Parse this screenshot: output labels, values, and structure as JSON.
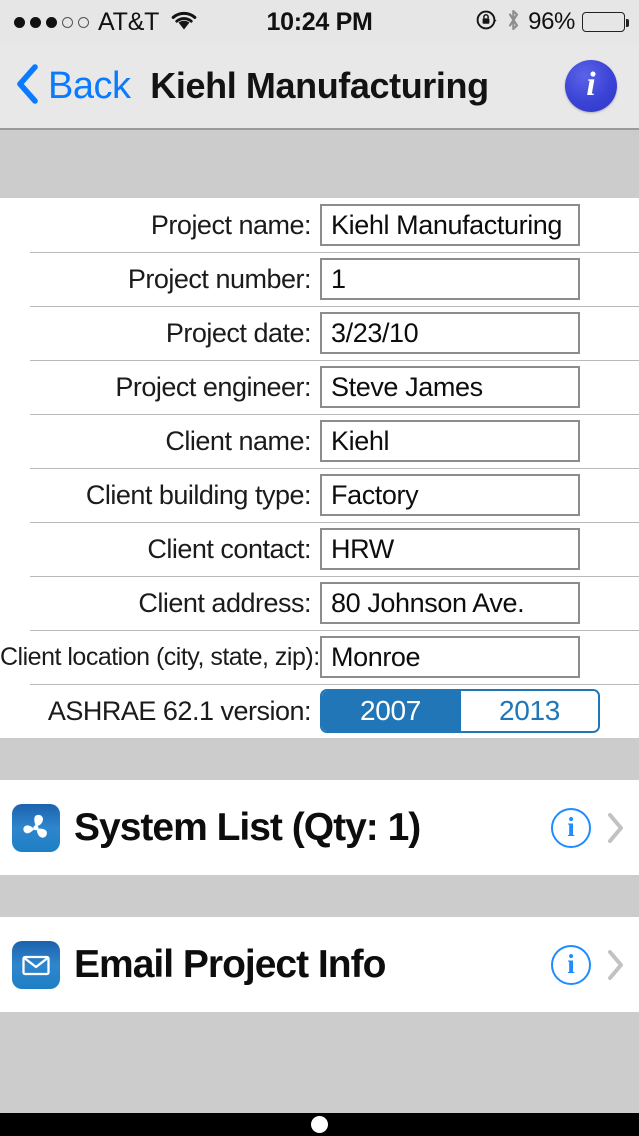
{
  "status_bar": {
    "carrier": "AT&T",
    "signal_filled": 3,
    "signal_total": 5,
    "time": "10:24 PM",
    "battery_percent": "96%",
    "battery_level": 96,
    "icons": [
      "wifi-icon",
      "rotation-lock-icon",
      "bluetooth-icon",
      "battery-icon"
    ]
  },
  "navbar": {
    "back_label": "Back",
    "title": "Kiehl Manufacturing",
    "info_glyph": "i"
  },
  "form": {
    "rows": [
      {
        "label": "Project name:",
        "value": "Kiehl Manufacturing"
      },
      {
        "label": "Project number:",
        "value": "1"
      },
      {
        "label": "Project date:",
        "value": "3/23/10"
      },
      {
        "label": "Project engineer:",
        "value": "Steve James"
      },
      {
        "label": "Client name:",
        "value": "Kiehl"
      },
      {
        "label": "Client building type:",
        "value": "Factory"
      },
      {
        "label": "Client contact:",
        "value": "HRW"
      },
      {
        "label": "Client address:",
        "value": "80 Johnson Ave."
      },
      {
        "label": "Client location (city, state, zip):",
        "value": "Monroe"
      }
    ],
    "segmented_row": {
      "label": "ASHRAE 62.1 version:",
      "options": [
        "2007",
        "2013"
      ],
      "selected": "2007"
    }
  },
  "list": {
    "items": [
      {
        "label": "System List (Qty: 1)",
        "icon": "fan-icon",
        "info_glyph": "i"
      },
      {
        "label": "Email Project Info",
        "icon": "envelope-icon",
        "info_glyph": "i"
      }
    ]
  },
  "colors": {
    "tint_blue": "#0a7bff",
    "segment_blue": "#2176b8",
    "info_blue": "#1f8cff",
    "section_gray": "#cccccc",
    "navbar_gray": "#e8e8e8"
  }
}
